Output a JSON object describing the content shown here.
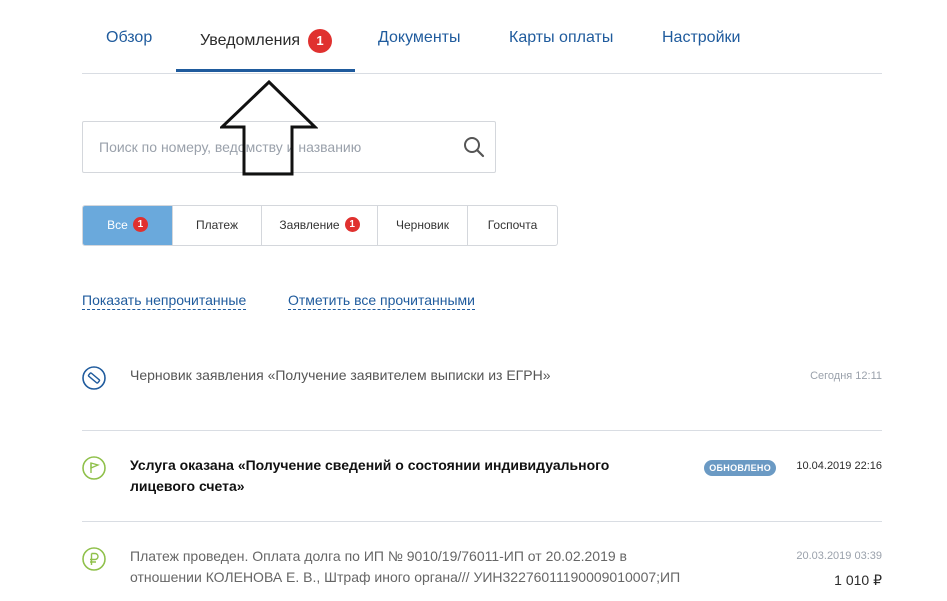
{
  "tabs": [
    {
      "label": "Обзор"
    },
    {
      "label": "Уведомления",
      "badge": "1"
    },
    {
      "label": "Документы"
    },
    {
      "label": "Карты оплаты"
    },
    {
      "label": "Настройки"
    }
  ],
  "search": {
    "placeholder": "Поиск по номеру, ведомству и названию"
  },
  "filters": [
    {
      "label": "Все",
      "badge": "1"
    },
    {
      "label": "Платеж"
    },
    {
      "label": "Заявление",
      "badge": "1"
    },
    {
      "label": "Черновик"
    },
    {
      "label": "Госпочта"
    }
  ],
  "links": {
    "show_unread": "Показать непрочитанные",
    "mark_all_read": "Отметить все прочитанными"
  },
  "notifications": [
    {
      "icon": "draft-icon",
      "text": "Черновик заявления «Получение заявителем выписки из ЕГРН»",
      "date": "Сегодня 12:11"
    },
    {
      "icon": "flag-icon",
      "text": "Услуга оказана «Получение сведений о состоянии индивидуального лицевого счета»",
      "status": "ОБНОВЛЕНО",
      "date": "10.04.2019 22:16"
    },
    {
      "icon": "ruble-icon",
      "text": "Платеж проведен. Оплата долга по ИП № 9010/19/76011-ИП от 20.02.2019 в отношении КОЛЕНОВА Е. В., Штраф иного органа/// УИН32276011190009010007;ИП",
      "date": "20.03.2019 03:39",
      "amount": "1 010 ₽"
    }
  ],
  "colors": {
    "accent": "#1f5b9d",
    "active_filter": "#6aa9dc",
    "badge": "#e0312f",
    "status_pill": "#6b9ac4",
    "success_icon": "#8fc04a"
  }
}
